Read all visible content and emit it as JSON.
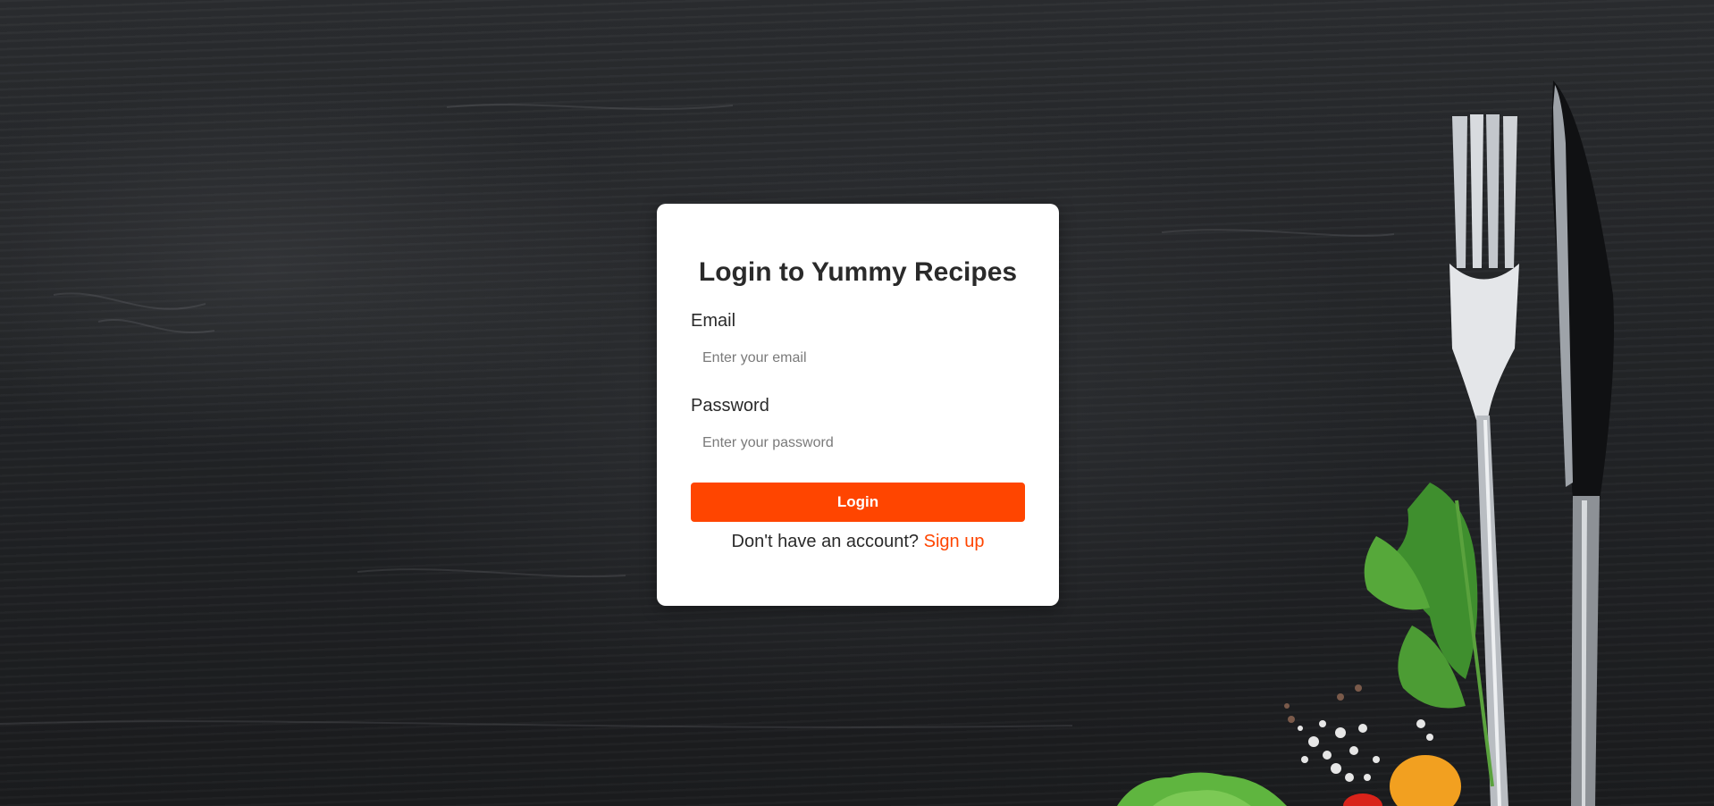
{
  "login": {
    "title": "Login to Yummy Recipes",
    "email_label": "Email",
    "email_placeholder": "Enter your email",
    "email_value": "",
    "password_label": "Password",
    "password_placeholder": "Enter your password",
    "password_value": "",
    "submit_label": "Login",
    "signup_prompt": "Don't have an account?",
    "signup_link": "Sign up"
  },
  "colors": {
    "accent": "#ff4500",
    "background": "#222427",
    "card": "#ffffff",
    "text": "#2a2a2a"
  },
  "icons": {
    "background_items": [
      "fork-icon",
      "knife-icon",
      "parsley-icon",
      "salt-icon",
      "tomato-icon",
      "lettuce-icon"
    ]
  }
}
